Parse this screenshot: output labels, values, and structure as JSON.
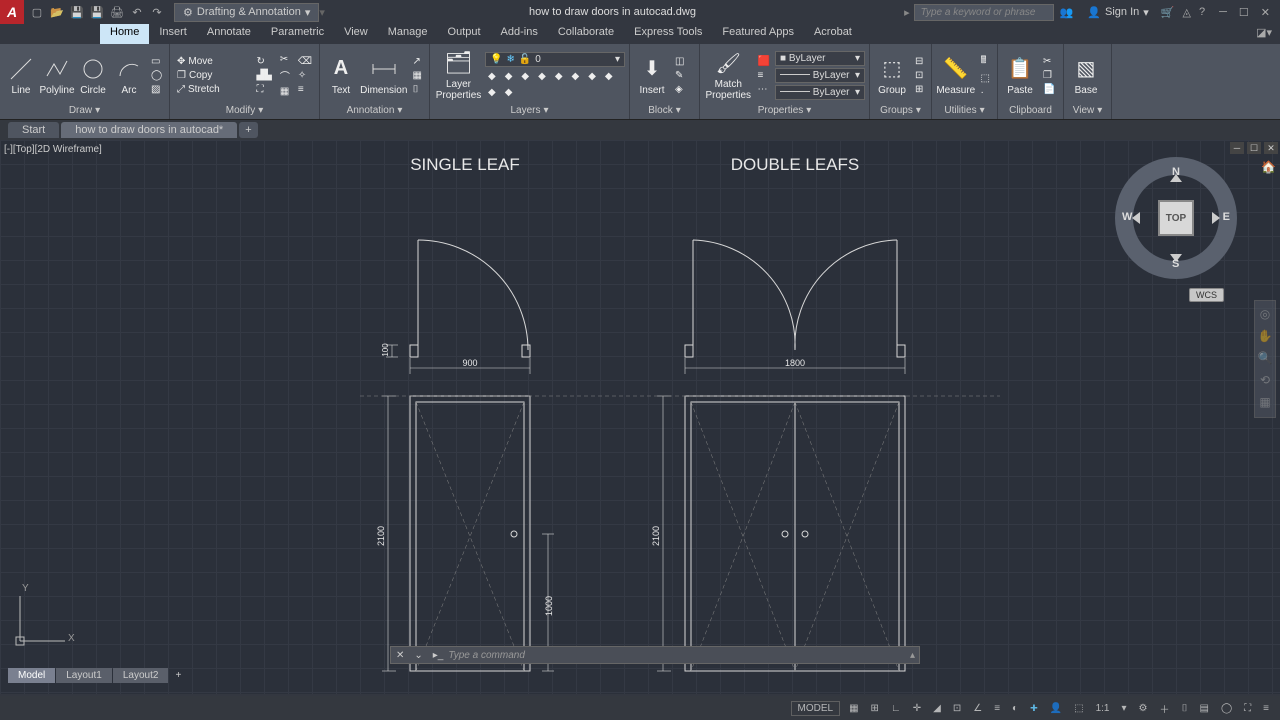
{
  "title_file": "how to draw doors in autocad.dwg",
  "workspace": "Drafting & Annotation",
  "search_placeholder": "Type a keyword or phrase",
  "signin": "Sign In",
  "tabs": [
    "Home",
    "Insert",
    "Annotate",
    "Parametric",
    "View",
    "Manage",
    "Output",
    "Add-ins",
    "Collaborate",
    "Express Tools",
    "Featured Apps",
    "Acrobat"
  ],
  "active_tab": "Home",
  "panels": {
    "draw": {
      "title": "Draw",
      "items": [
        "Line",
        "Polyline",
        "Circle",
        "Arc"
      ]
    },
    "modify": {
      "title": "Modify",
      "items": [
        "Move",
        "Copy",
        "Stretch"
      ]
    },
    "annotation": {
      "title": "Annotation",
      "items": [
        "Text",
        "Dimension"
      ]
    },
    "layers": {
      "title": "Layers",
      "btn": "Layer Properties"
    },
    "block": {
      "title": "Block",
      "btn": "Insert"
    },
    "properties": {
      "title": "Properties",
      "btn": "Match Properties",
      "combo1": "ByLayer",
      "combo2": "ByLayer",
      "combo3": "ByLayer"
    },
    "groups": {
      "title": "Groups",
      "btn": "Group"
    },
    "utilities": {
      "title": "Utilities",
      "btn": "Measure"
    },
    "clipboard": {
      "title": "Clipboard",
      "btn": "Paste"
    },
    "view": {
      "title": "View",
      "btn": "Base"
    }
  },
  "file_tabs": [
    "Start",
    "how to draw doors in autocad*"
  ],
  "viewport_label": "[-][Top][2D Wireframe]",
  "drawing": {
    "title_single": "SINGLE LEAF",
    "title_double": "DOUBLE LEAFS",
    "dim_100": "100",
    "dim_900": "900",
    "dim_1800": "1800",
    "dim_2100_a": "2100",
    "dim_2100_b": "2100",
    "dim_1000": "1000"
  },
  "wcs": "WCS",
  "viewcube": {
    "top": "TOP",
    "n": "N",
    "s": "S",
    "e": "E",
    "w": "W"
  },
  "command_placeholder": "Type a command",
  "layout_tabs": [
    "Model",
    "Layout1",
    "Layout2"
  ],
  "status": {
    "model": "MODEL",
    "scale": "1:1"
  },
  "ucs": {
    "x": "X",
    "y": "Y"
  }
}
